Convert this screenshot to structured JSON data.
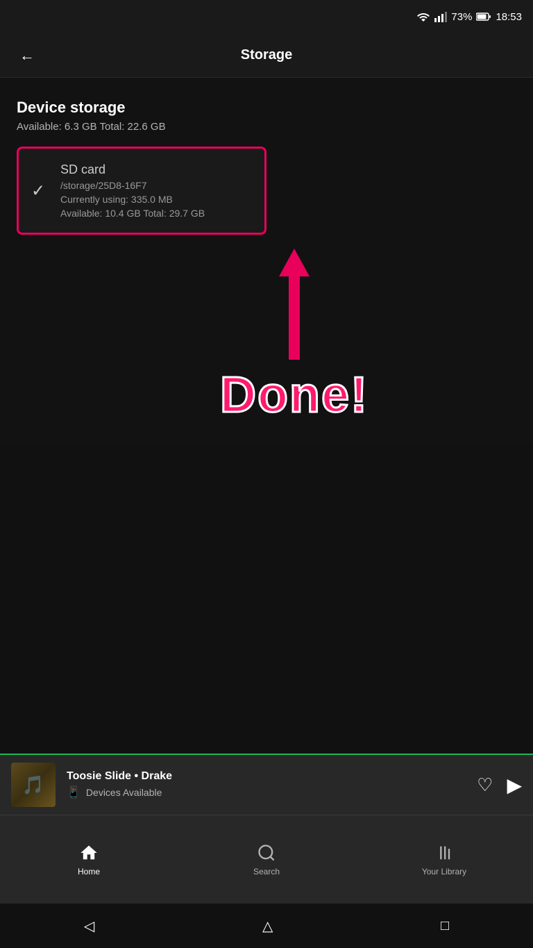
{
  "statusBar": {
    "battery": "73%",
    "time": "18:53"
  },
  "topNav": {
    "title": "Storage",
    "backArrow": "←"
  },
  "deviceStorage": {
    "label": "Device storage",
    "info": "Available: 6.3 GB  Total: 22.6 GB"
  },
  "sdCard": {
    "title": "SD card",
    "path": "/storage/25D8-16F7",
    "using": "Currently using: 335.0 MB",
    "available": "Available: 10.4 GB  Total: 29.7 GB"
  },
  "annotation": {
    "doneText": "Done!"
  },
  "nowPlaying": {
    "title": "Toosie Slide • Drake",
    "devices": "Devices Available"
  },
  "bottomNav": {
    "home": "Home",
    "search": "Search",
    "library": "Your Library"
  },
  "androidNav": {
    "back": "◁",
    "home": "△",
    "recents": "□"
  }
}
